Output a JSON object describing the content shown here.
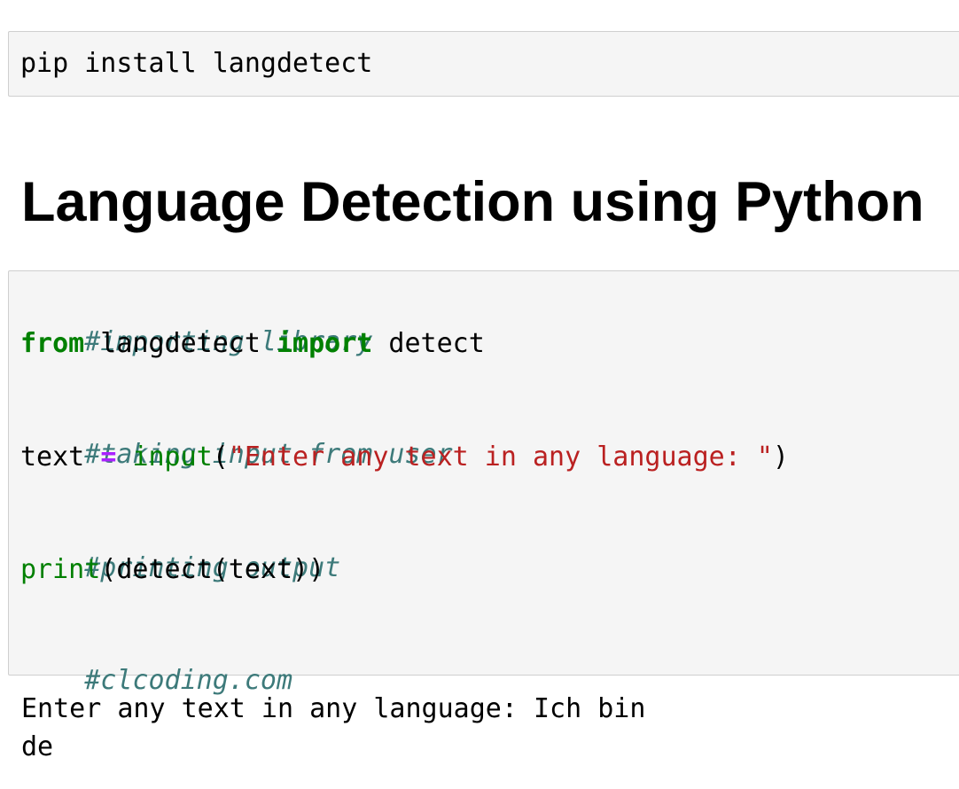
{
  "install_cell": {
    "code": "pip install langdetect"
  },
  "heading": {
    "text": "Language Detection using Python"
  },
  "code_cell": {
    "comment_import": "#importing library",
    "from_kw": "from",
    "module": " langdetect ",
    "import_kw": "import",
    "import_name": " detect",
    "comment_input": "#taking input from user",
    "var_text": "text ",
    "assign_op": "=",
    "space": " ",
    "input_fn": "input",
    "paren_open": "(",
    "prompt_string": "\"Enter any text in any language: \"",
    "paren_close": ")",
    "comment_print": "#printing output",
    "print_fn": "print",
    "print_args": "(detect(text))",
    "comment_site": "#clcoding.com"
  },
  "output": {
    "line1": "Enter any text in any language: Ich bin",
    "line2": "de"
  }
}
